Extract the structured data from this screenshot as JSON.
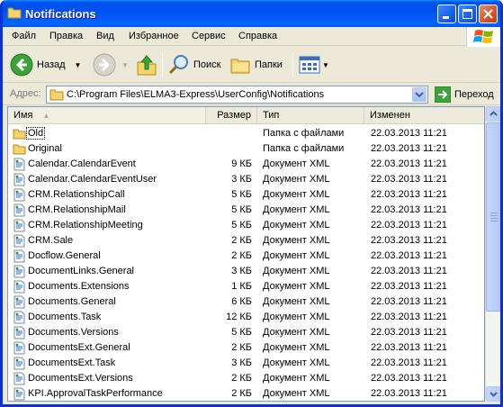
{
  "window": {
    "title": "Notifications"
  },
  "menu": [
    "Файл",
    "Правка",
    "Вид",
    "Избранное",
    "Сервис",
    "Справка"
  ],
  "toolbar": {
    "back_label": "Назад",
    "search_label": "Поиск",
    "folders_label": "Папки"
  },
  "address": {
    "label": "Адрес:",
    "path": "C:\\Program Files\\ELMA3-Express\\UserConfig\\Notifications",
    "go_label": "Переход"
  },
  "columns": {
    "name": "Имя",
    "size": "Размер",
    "type": "Тип",
    "modified": "Изменен"
  },
  "files": [
    {
      "name": "Old",
      "size": "",
      "type": "Папка с файлами",
      "modified": "22.03.2013 11:21",
      "icon": "folder-icon"
    },
    {
      "name": "Original",
      "size": "",
      "type": "Папка с файлами",
      "modified": "22.03.2013 11:21",
      "icon": "folder-icon"
    },
    {
      "name": "Calendar.CalendarEvent",
      "size": "9 КБ",
      "type": "Документ XML",
      "modified": "22.03.2013 11:21",
      "icon": "xml-file-icon"
    },
    {
      "name": "Calendar.CalendarEventUser",
      "size": "3 КБ",
      "type": "Документ XML",
      "modified": "22.03.2013 11:21",
      "icon": "xml-file-icon"
    },
    {
      "name": "CRM.RelationshipCall",
      "size": "5 КБ",
      "type": "Документ XML",
      "modified": "22.03.2013 11:21",
      "icon": "xml-file-icon"
    },
    {
      "name": "CRM.RelationshipMail",
      "size": "5 КБ",
      "type": "Документ XML",
      "modified": "22.03.2013 11:21",
      "icon": "xml-file-icon"
    },
    {
      "name": "CRM.RelationshipMeeting",
      "size": "5 КБ",
      "type": "Документ XML",
      "modified": "22.03.2013 11:21",
      "icon": "xml-file-icon"
    },
    {
      "name": "CRM.Sale",
      "size": "2 КБ",
      "type": "Документ XML",
      "modified": "22.03.2013 11:21",
      "icon": "xml-file-icon"
    },
    {
      "name": "Docflow.General",
      "size": "2 КБ",
      "type": "Документ XML",
      "modified": "22.03.2013 11:21",
      "icon": "xml-file-icon"
    },
    {
      "name": "DocumentLinks.General",
      "size": "3 КБ",
      "type": "Документ XML",
      "modified": "22.03.2013 11:21",
      "icon": "xml-file-icon"
    },
    {
      "name": "Documents.Extensions",
      "size": "1 КБ",
      "type": "Документ XML",
      "modified": "22.03.2013 11:21",
      "icon": "xml-file-icon"
    },
    {
      "name": "Documents.General",
      "size": "6 КБ",
      "type": "Документ XML",
      "modified": "22.03.2013 11:21",
      "icon": "xml-file-icon"
    },
    {
      "name": "Documents.Task",
      "size": "12 КБ",
      "type": "Документ XML",
      "modified": "22.03.2013 11:21",
      "icon": "xml-file-icon"
    },
    {
      "name": "Documents.Versions",
      "size": "5 КБ",
      "type": "Документ XML",
      "modified": "22.03.2013 11:21",
      "icon": "xml-file-icon"
    },
    {
      "name": "DocumentsExt.General",
      "size": "2 КБ",
      "type": "Документ XML",
      "modified": "22.03.2013 11:21",
      "icon": "xml-file-icon"
    },
    {
      "name": "DocumentsExt.Task",
      "size": "3 КБ",
      "type": "Документ XML",
      "modified": "22.03.2013 11:21",
      "icon": "xml-file-icon"
    },
    {
      "name": "DocumentsExt.Versions",
      "size": "2 КБ",
      "type": "Документ XML",
      "modified": "22.03.2013 11:21",
      "icon": "xml-file-icon"
    },
    {
      "name": "KPI.ApprovalTaskPerformance",
      "size": "2 КБ",
      "type": "Документ XML",
      "modified": "22.03.2013 11:21",
      "icon": "xml-file-icon"
    }
  ]
}
